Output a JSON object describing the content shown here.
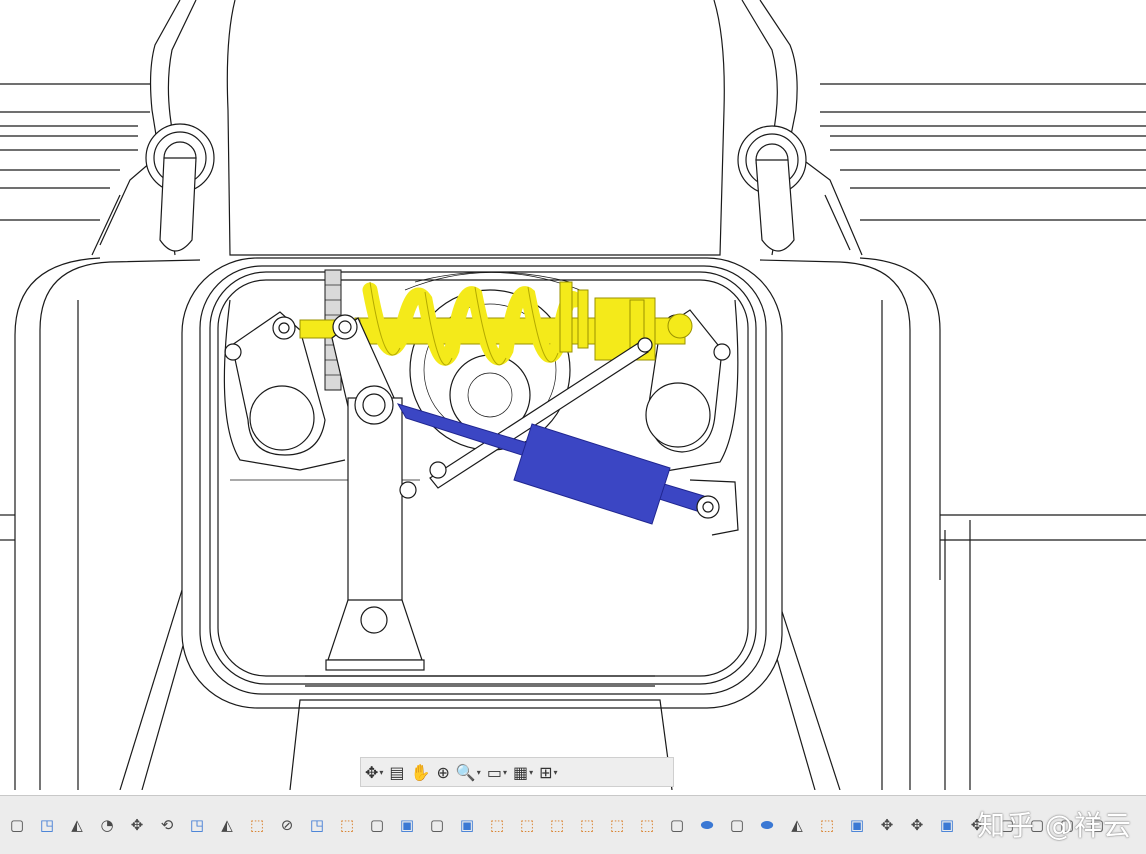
{
  "view_toolbar": [
    {
      "icon": "move-triad-icon",
      "glyph": "✥",
      "caret": "▾"
    },
    {
      "icon": "look-at-icon",
      "glyph": "▤",
      "caret": ""
    },
    {
      "icon": "pan-hand-icon",
      "glyph": "✋",
      "caret": ""
    },
    {
      "icon": "zoom-window-icon",
      "glyph": "⊕",
      "caret": ""
    },
    {
      "icon": "zoom-icon",
      "glyph": "🔍",
      "caret": "▾"
    },
    {
      "icon": "display-style-icon",
      "glyph": "▭",
      "caret": "▾"
    },
    {
      "icon": "grid-icon",
      "glyph": "▦",
      "caret": "▾"
    },
    {
      "icon": "multi-view-icon",
      "glyph": "⊞",
      "caret": "▾"
    }
  ],
  "command_toolbar": [
    {
      "icon": "box-icon",
      "glyph": "▢",
      "tone": "gray"
    },
    {
      "icon": "sheet-fold-icon",
      "glyph": "◳",
      "tone": "blue"
    },
    {
      "icon": "draft-icon",
      "glyph": "◭",
      "tone": "gray"
    },
    {
      "icon": "fillet-icon",
      "glyph": "◔",
      "tone": "gray"
    },
    {
      "icon": "move-icon",
      "glyph": "✥",
      "tone": "gray"
    },
    {
      "icon": "rotate-icon",
      "glyph": "⟲",
      "tone": "gray"
    },
    {
      "icon": "extrude-icon",
      "glyph": "◳",
      "tone": "blue"
    },
    {
      "icon": "shell-icon",
      "glyph": "◭",
      "tone": "gray"
    },
    {
      "icon": "sketch-icon",
      "glyph": "⬚",
      "tone": "orange"
    },
    {
      "icon": "revolve-icon",
      "glyph": "⊘",
      "tone": "gray"
    },
    {
      "icon": "flange-icon",
      "glyph": "◳",
      "tone": "blue"
    },
    {
      "icon": "project-icon",
      "glyph": "⬚",
      "tone": "orange"
    },
    {
      "icon": "solid-icon",
      "glyph": "▢",
      "tone": "gray"
    },
    {
      "icon": "solid-blue-icon",
      "glyph": "▣",
      "tone": "blue"
    },
    {
      "icon": "solid-2-icon",
      "glyph": "▢",
      "tone": "gray"
    },
    {
      "icon": "solid-blue-2-icon",
      "glyph": "▣",
      "tone": "blue"
    },
    {
      "icon": "sketch-2-icon",
      "glyph": "⬚",
      "tone": "orange"
    },
    {
      "icon": "sketch-3-icon",
      "glyph": "⬚",
      "tone": "orange"
    },
    {
      "icon": "sketch-4-icon",
      "glyph": "⬚",
      "tone": "orange"
    },
    {
      "icon": "sketch-5-icon",
      "glyph": "⬚",
      "tone": "orange"
    },
    {
      "icon": "sketch-6-icon",
      "glyph": "⬚",
      "tone": "orange"
    },
    {
      "icon": "sketch-7-icon",
      "glyph": "⬚",
      "tone": "orange"
    },
    {
      "icon": "solid-3-icon",
      "glyph": "▢",
      "tone": "gray"
    },
    {
      "icon": "cylinder-icon",
      "glyph": "⬬",
      "tone": "blue"
    },
    {
      "icon": "solid-4-icon",
      "glyph": "▢",
      "tone": "gray"
    },
    {
      "icon": "cylinder-2-icon",
      "glyph": "⬬",
      "tone": "blue"
    },
    {
      "icon": "draft-2-icon",
      "glyph": "◭",
      "tone": "gray"
    },
    {
      "icon": "sketch-8-icon",
      "glyph": "⬚",
      "tone": "orange"
    },
    {
      "icon": "solid-blue-3-icon",
      "glyph": "▣",
      "tone": "blue"
    },
    {
      "icon": "move-2-icon",
      "glyph": "✥",
      "tone": "gray"
    },
    {
      "icon": "move-3-icon",
      "glyph": "✥",
      "tone": "gray"
    },
    {
      "icon": "solid-blue-4-icon",
      "glyph": "▣",
      "tone": "blue"
    },
    {
      "icon": "move-4-icon",
      "glyph": "✥",
      "tone": "gray"
    },
    {
      "icon": "solid-5-icon",
      "glyph": "▢",
      "tone": "gray"
    },
    {
      "icon": "solid-6-icon",
      "glyph": "▢",
      "tone": "gray"
    },
    {
      "icon": "solid-7-icon",
      "glyph": "▢",
      "tone": "gray"
    },
    {
      "icon": "solid-8-icon",
      "glyph": "▢",
      "tone": "gray"
    }
  ],
  "watermark": "知乎 @祥云",
  "colors": {
    "spring": "#f4ea1a",
    "damper": "#3b46c4",
    "line": "#1a1a1a",
    "background": "#ffffff",
    "toolbar": "#ececec"
  }
}
